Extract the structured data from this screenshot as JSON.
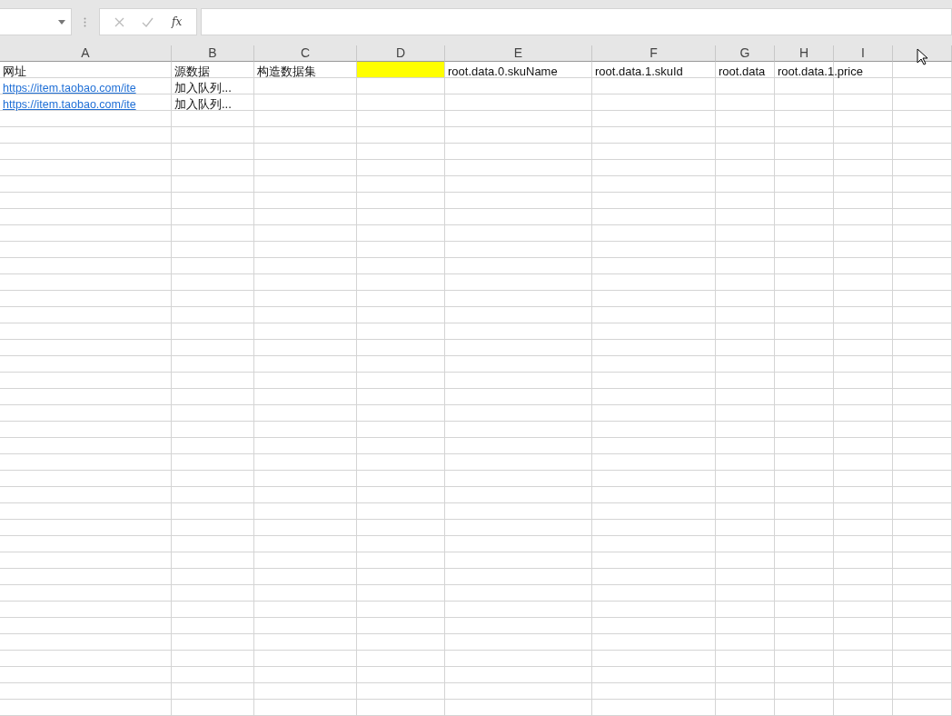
{
  "formula_bar": {
    "function_label": "fx"
  },
  "columns": [
    "A",
    "B",
    "C",
    "D",
    "E",
    "F",
    "G",
    "H",
    "I"
  ],
  "rows": [
    {
      "cells": [
        {
          "kind": "text",
          "text": "网址"
        },
        {
          "kind": "text",
          "text": "源数据"
        },
        {
          "kind": "text",
          "text": "构造数据集"
        },
        {
          "kind": "fill",
          "color": "#ffff00"
        },
        {
          "kind": "text",
          "text": "root.data.0.skuName"
        },
        {
          "kind": "text",
          "text": "root.data.1.skuId"
        },
        {
          "kind": "text",
          "text": "root.data"
        },
        {
          "kind": "text",
          "text": "root.data.1.price"
        },
        null,
        null
      ]
    },
    {
      "cells": [
        {
          "kind": "link",
          "text": "https://item.taobao.com/ite"
        },
        {
          "kind": "text",
          "text": "加入队列..."
        },
        null,
        null,
        null,
        null,
        null,
        null,
        null,
        null
      ]
    },
    {
      "cells": [
        {
          "kind": "link",
          "text": "https://item.taobao.com/ite"
        },
        {
          "kind": "text",
          "text": "加入队列..."
        },
        null,
        null,
        null,
        null,
        null,
        null,
        null,
        null
      ]
    }
  ]
}
